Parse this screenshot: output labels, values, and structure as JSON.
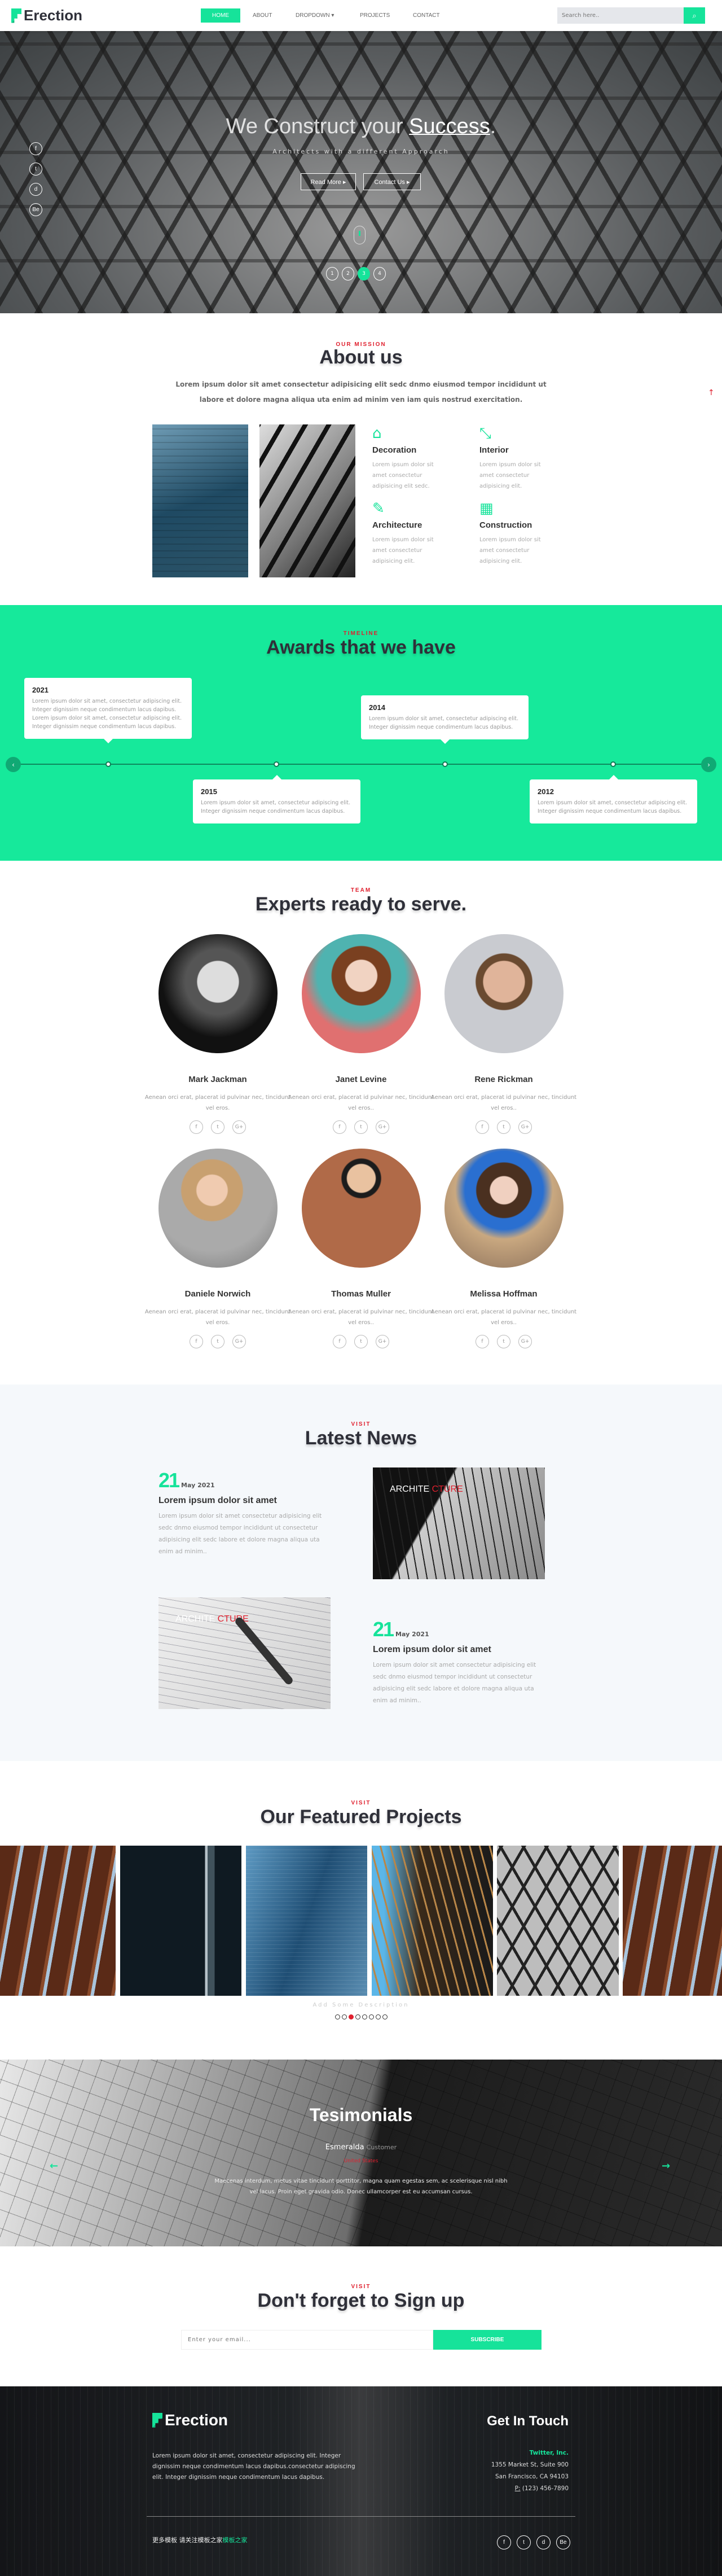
{
  "brand": {
    "name": "Erection",
    "accent": "#16e39a",
    "kicker_color": "#e0202e"
  },
  "nav": {
    "items": [
      {
        "label": "HOME",
        "active": true
      },
      {
        "label": "ABOUT"
      },
      {
        "label": "DROPDOWN ▾"
      },
      {
        "label": "PROJECTS"
      },
      {
        "label": "CONTACT"
      }
    ],
    "search_placeholder": "Search here..",
    "search_icon": "search-icon"
  },
  "hero": {
    "title_light": "We Construct your ",
    "title_bold": "Success",
    "title_end": ".",
    "subtitle": "Architects with a different Approarch",
    "buttons": [
      "Read More ▸",
      "Contact Us ▸"
    ],
    "social": [
      "f",
      "t",
      "d",
      "Be"
    ],
    "pages": [
      "1",
      "2",
      "3",
      "4"
    ],
    "active_page": 3
  },
  "about": {
    "kicker": "OUR MISSION",
    "title": "About us",
    "intro": "Lorem ipsum dolor sit amet consectetur adipisicing elit sedc dnmo eiusmod tempor incididunt ut labore et dolore magna aliqua uta enim ad minim ven iam quis nostrud exercitation.",
    "features": [
      {
        "icon": "home-icon",
        "title": "Decoration",
        "text": "Lorem ipsum dolor sit amet consectetur adipisicing elit sedc."
      },
      {
        "icon": "compress-icon",
        "title": "Interior",
        "text": "Lorem ipsum dolor sit amet consectetur adipisicing elit."
      },
      {
        "icon": "pencil-icon",
        "title": "Architecture",
        "text": "Lorem ipsum dolor sit amet consectetur adipisicing elit."
      },
      {
        "icon": "building-icon",
        "title": "Construction",
        "text": "Lorem ipsum dolor sit amet consectetur adipisicing elit."
      }
    ]
  },
  "awards": {
    "kicker": "TIMELINE",
    "title": "Awards that we have",
    "items": [
      {
        "year": "2021",
        "text": "Lorem ipsum dolor sit amet, consectetur adipiscing elit. Integer dignissim neque condimentum lacus dapibus. Lorem ipsum dolor sit amet, consectetur adipiscing elit. Integer dignissim neque condimentum lacus dapibus."
      },
      {
        "year": "2015",
        "text": "Lorem ipsum dolor sit amet, consectetur adipiscing elit. Integer dignissim neque condimentum lacus dapibus."
      },
      {
        "year": "2014",
        "text": "Lorem ipsum dolor sit amet, consectetur adipiscing elit. Integer dignissim neque condimentum lacus dapibus."
      },
      {
        "year": "2012",
        "text": "Lorem ipsum dolor sit amet, consectetur adipiscing elit. Integer dignissim neque condimentum lacus dapibus."
      }
    ]
  },
  "team": {
    "kicker": "TEAM",
    "title": "Experts ready to serve.",
    "members": [
      {
        "name": "Mark Jackman",
        "desc": "Aenean orci erat, placerat id pulvinar nec, tincidunt vel eros."
      },
      {
        "name": "Janet Levine",
        "desc": "Aenean orci erat, placerat id pulvinar nec, tincidunt vel eros.."
      },
      {
        "name": "Rene Rickman",
        "desc": "Aenean orci erat, placerat id pulvinar nec, tincidunt vel eros.."
      },
      {
        "name": "Daniele Norwich",
        "desc": "Aenean orci erat, placerat id pulvinar nec, tincidunt vel eros."
      },
      {
        "name": "Thomas Muller",
        "desc": "Aenean orci erat, placerat id pulvinar nec, tincidunt vel eros.."
      },
      {
        "name": "Melissa Hoffman",
        "desc": "Aenean orci erat, placerat id pulvinar nec, tincidunt vel eros.."
      }
    ],
    "social": [
      "f",
      "t",
      "G+"
    ]
  },
  "news": {
    "kicker": "VISIT",
    "title": "Latest News",
    "items": [
      {
        "day": "21",
        "month": "May 2021",
        "title": "Lorem ipsum dolor sit amet",
        "text": "Lorem ipsum dolor sit amet consectetur adipisicing elit sedc dnmo eiusmod tempor incididunt ut consectetur adipisicing elit sedc labore et dolore magna aliqua uta enim ad minim..",
        "image_label_a": "ARCHITE ",
        "image_label_b": "CTURE"
      },
      {
        "day": "21",
        "month": "May 2021",
        "title": "Lorem ipsum dolor sit amet",
        "text": "Lorem ipsum dolor sit amet consectetur adipisicing elit sedc dnmo eiusmod tempor incididunt ut consectetur adipisicing elit sedc labore et dolore magna aliqua uta enim ad minim..",
        "image_label_a": "ARCHITE ",
        "image_label_b": "CTURE"
      }
    ]
  },
  "projects": {
    "kicker": "VISIT",
    "title": "Our Featured Projects",
    "description": "Add Some Description",
    "dots": 8,
    "active_dot": 3
  },
  "testimonials": {
    "title": "Tesimonials",
    "name": "Esmeralda",
    "role": "Customer",
    "location": "United States",
    "quote": "Maecenas interdum, metus vitae tincidunt porttitor, magna quam egestas sem, ac scelerisque nisl nibh vel lacus. Proin eget gravida odio. Donec ullamcorper est eu accumsan cursus.",
    "prev": "←",
    "next": "→"
  },
  "signup": {
    "kicker": "VISIT",
    "title": "Don't forget to Sign up",
    "placeholder": "Enter your email...",
    "button": "SUBSCRIBE"
  },
  "footer": {
    "text": "Lorem ipsum dolor sit amet, consectetur adipiscing elit. Integer dignissim neque condimentum lacus dapibus.consectetur adipiscing elit. Integer dignissim neque condimentum lacus dapibus.",
    "contact_title": "Get In Touch",
    "company": "Twitter, Inc.",
    "address1": "1355 Market St, Suite 900",
    "address2": "San Francisco, CA 94103",
    "phone_label": "P:",
    "phone": "(123) 456-7890",
    "copyright": "更多模板 请关注模板之家",
    "copyright_link": "模板之家",
    "social": [
      "f",
      "t",
      "d",
      "Be"
    ]
  }
}
